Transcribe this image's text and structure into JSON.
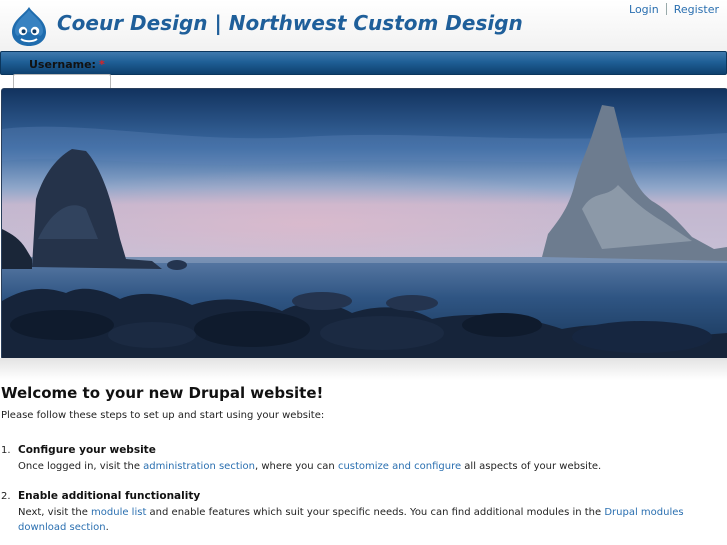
{
  "site": {
    "name": "Coeur Design | Northwest Custom Design",
    "logo_icon": "drupal-drop-icon"
  },
  "user_links": {
    "login": "Login",
    "register": "Register"
  },
  "login_form": {
    "username_label": "Username:",
    "required_marker": "*"
  },
  "banner": {
    "image": "coastal-sea-stacks-at-dusk"
  },
  "content": {
    "title": "Welcome to your new Drupal website!",
    "intro": "Please follow these steps to set up and start using your website:",
    "steps": [
      {
        "number": "1.",
        "title": "Configure your website",
        "text_1": "Once logged in, visit the ",
        "link_1": "administration section",
        "text_2": ", where you can ",
        "link_2": "customize and configure",
        "text_3": " all aspects of your website."
      },
      {
        "number": "2.",
        "title": "Enable additional functionality",
        "text_1": "Next, visit the ",
        "link_1": "module list",
        "text_2": " and enable features which suit your specific needs. You can find additional modules in the ",
        "link_2": "Drupal modules download section",
        "text_3": "."
      }
    ]
  },
  "colors": {
    "link": "#2a6fb0",
    "site_name": "#1f5f9a",
    "nav_bar": "#1f5f96",
    "required": "#dd2222"
  }
}
